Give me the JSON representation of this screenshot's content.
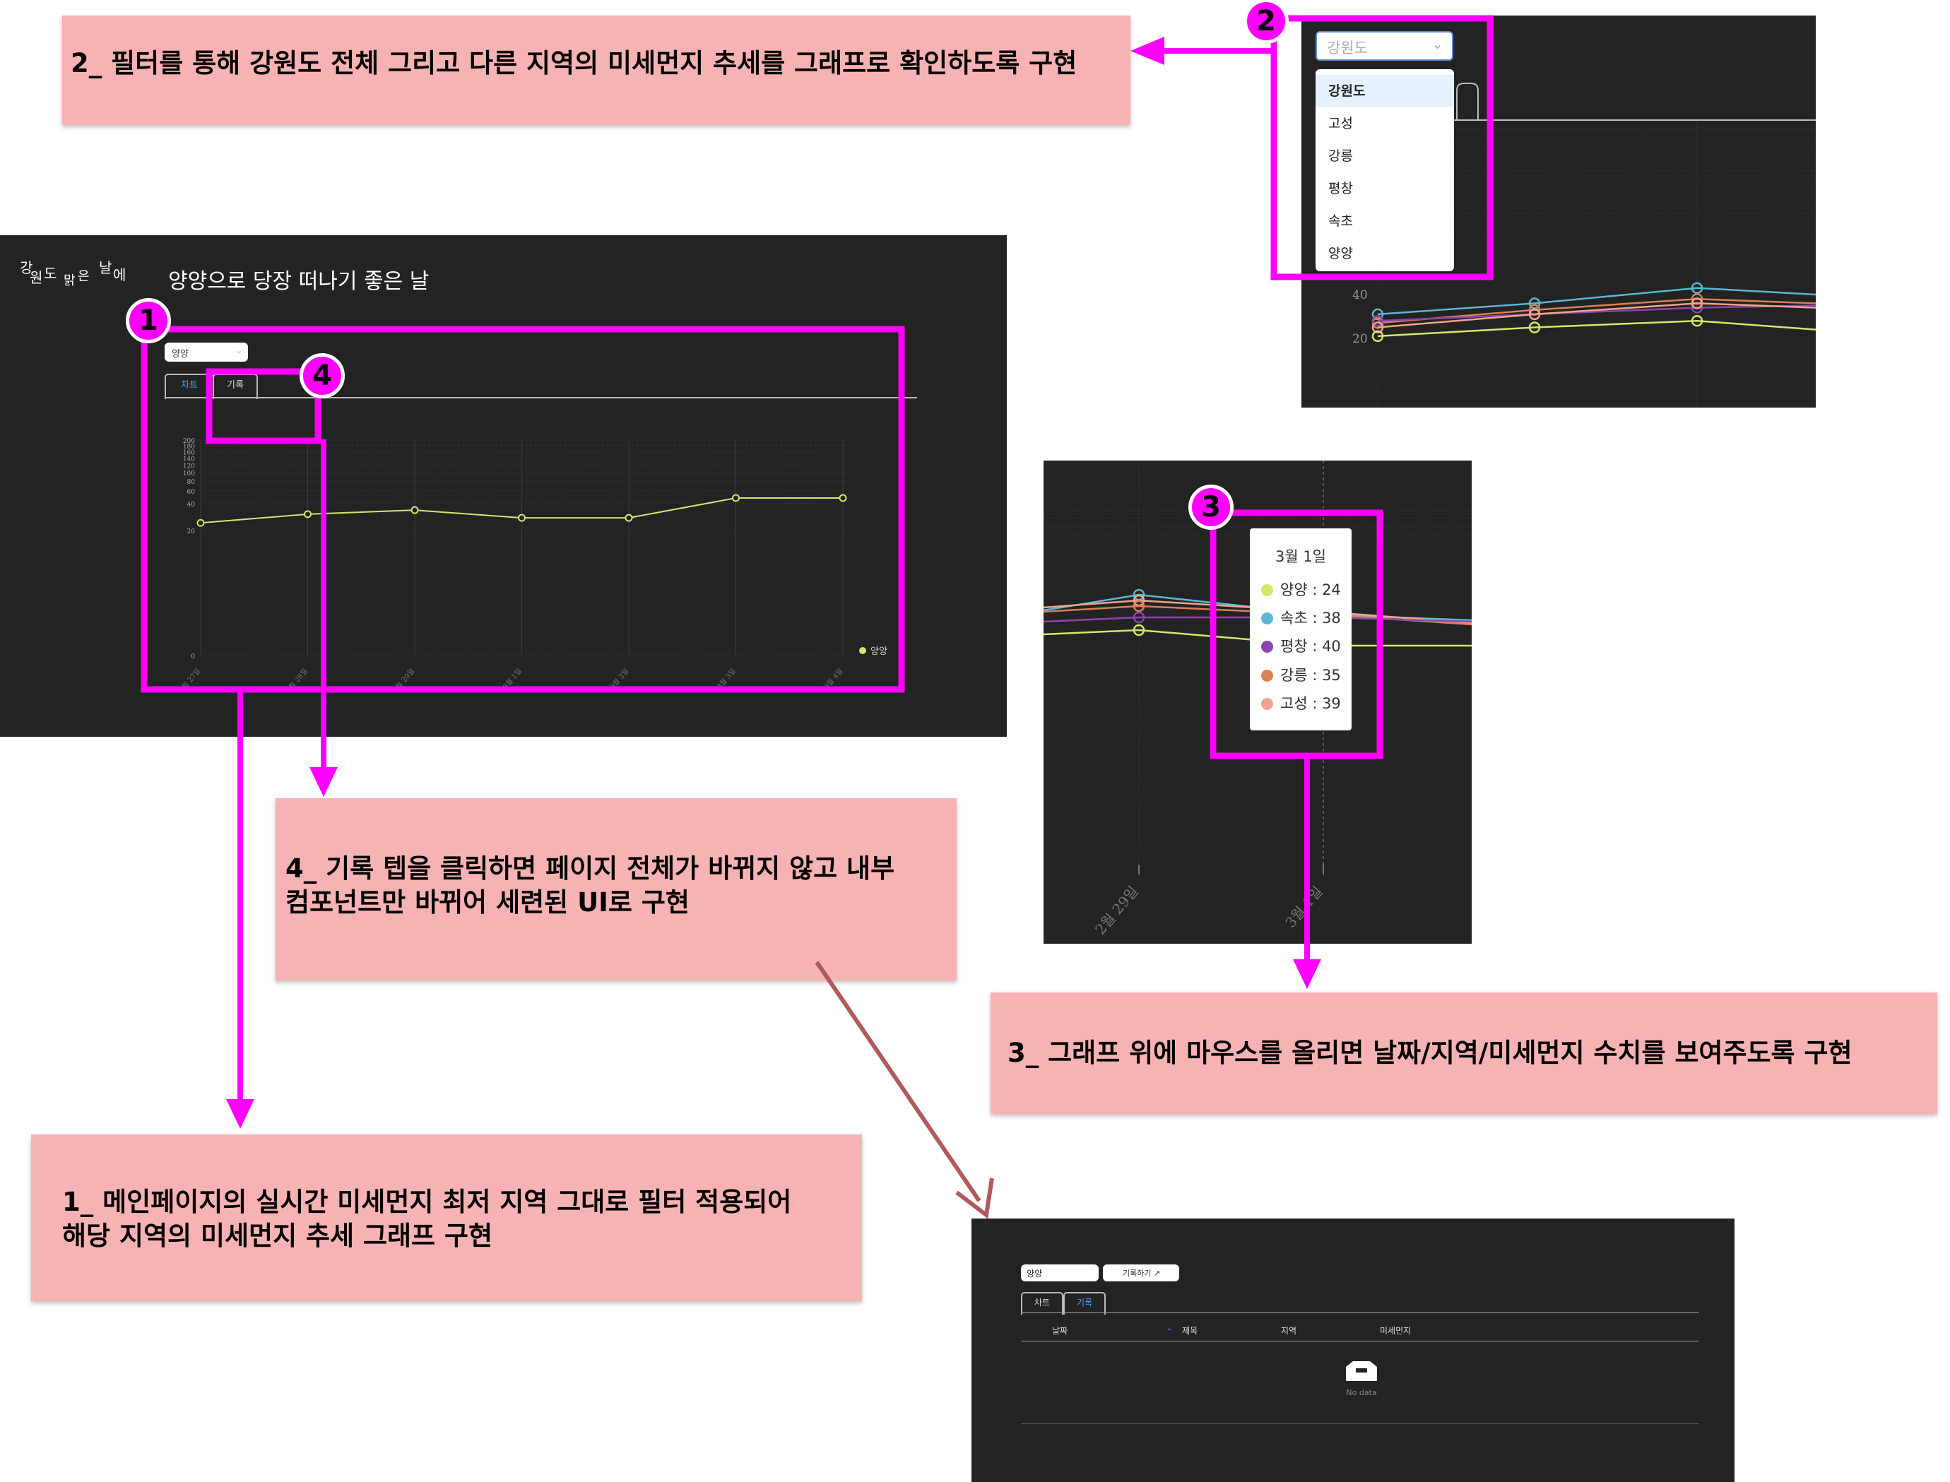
{
  "notes": {
    "note2": "2_ 필터를 통해 강원도 전체 그리고 다른 지역의 미세먼지 추세를 그래프로 확인하도록 구현",
    "note4": "4_ 기록 텝을 클릭하면 페이지 전체가 바뀌지 않고 내부\n컴포넌트만 바뀌어 세련된 UI로 구현",
    "note3": "3_ 그래프 위에 마우스를 올리면 날짜/지역/미세먼지 수치를 보여주도록 구현",
    "note1": "1_ 메인페이지의 실시간 미세먼지 최저 지역 그대로 필터 적용되어\n해당 지역의 미세먼지 추세 그래프 구현"
  },
  "badges": {
    "b1": "1",
    "b2": "2",
    "b3": "3",
    "b4": "4"
  },
  "main_screen": {
    "logo": "강원도 맑은 날에",
    "logo_parts": [
      "강",
      "원",
      "도",
      "맑",
      "은",
      "날",
      "에"
    ],
    "title": "양양으로 당장 떠나기 좋은 날",
    "region_select": "양양",
    "tabs": [
      "차트",
      "기록"
    ],
    "legend": "양양",
    "y_ticks": [
      "200",
      "180",
      "160",
      "140",
      "120",
      "100",
      "80",
      "60",
      "40",
      "20",
      "0"
    ],
    "x_ticks": [
      "2월 27일",
      "2월 28일",
      "2월 29일",
      "3월 1일",
      "3월 2일",
      "3월 3일",
      "3월 4일"
    ]
  },
  "dropdown_screen": {
    "placeholder": "강원도",
    "options": [
      "강원도",
      "고성",
      "강릉",
      "평창",
      "속초",
      "양양"
    ],
    "y_ticks": [
      "40",
      "20"
    ]
  },
  "tooltip_screen": {
    "date": "3월 1일",
    "rows": [
      {
        "label": "양양 : 24",
        "color": "#d7e66a"
      },
      {
        "label": "속초 : 38",
        "color": "#5bb8d4"
      },
      {
        "label": "평창 : 40",
        "color": "#8e44ad"
      },
      {
        "label": "강릉 : 35",
        "color": "#d98055"
      },
      {
        "label": "고성 : 39",
        "color": "#f1a48d"
      }
    ],
    "x_ticks": [
      "2월 29일",
      "3월 1일"
    ]
  },
  "record_screen": {
    "region_select": "양양",
    "record_button": "기록하기 ↗",
    "tabs": [
      "차트",
      "기록"
    ],
    "columns": [
      "날짜",
      "제목",
      "지역",
      "미세먼지"
    ],
    "empty_text": "No data"
  },
  "chart_data": [
    {
      "type": "line",
      "categories": [
        "2월 27일",
        "2월 28일",
        "2월 29일",
        "3월 1일",
        "3월 2일",
        "3월 3일",
        "3월 4일"
      ],
      "series": [
        {
          "name": "양양",
          "values": [
            22,
            28,
            32,
            25,
            25,
            48,
            48
          ]
        }
      ],
      "ylim": [
        0,
        200
      ],
      "title": "",
      "xlabel": "",
      "ylabel": ""
    },
    {
      "type": "line",
      "categories": [
        "2월 29일",
        "3월 1일"
      ],
      "series": [
        {
          "name": "양양",
          "values": [
            22,
            24
          ]
        },
        {
          "name": "속초",
          "values": [
            38,
            38
          ]
        },
        {
          "name": "평창",
          "values": [
            35,
            40
          ]
        },
        {
          "name": "강릉",
          "values": [
            33,
            35
          ]
        },
        {
          "name": "고성",
          "values": [
            36,
            39
          ]
        }
      ],
      "title": "",
      "xlabel": "",
      "ylabel": ""
    }
  ],
  "colors": {
    "magenta": "#ff00ff",
    "note_bg": "#f7b3b3",
    "panel_bg": "#232323",
    "line_yangyang": "#d7e66a",
    "line_sokcho": "#5bb8d4",
    "line_pyeongchang": "#8e44ad",
    "line_gangneung": "#d98055",
    "line_goseong": "#f1a48d",
    "arrow_brown": "#b05a5a"
  }
}
